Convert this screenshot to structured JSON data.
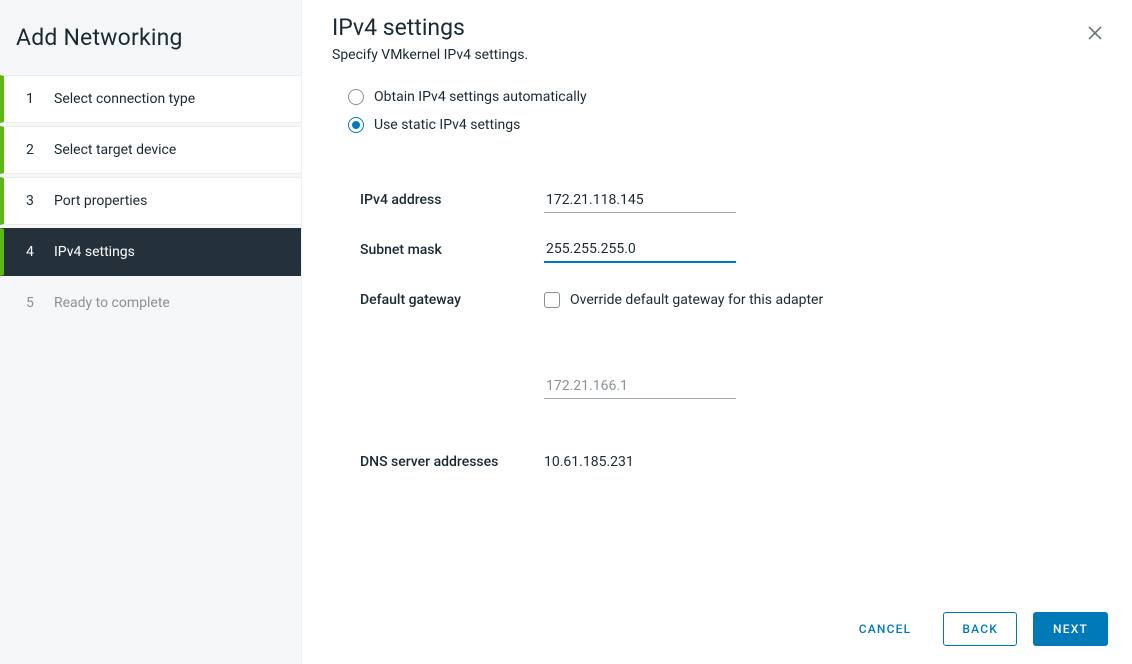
{
  "sidebar": {
    "title": "Add Networking",
    "steps": [
      {
        "num": "1",
        "label": "Select connection type"
      },
      {
        "num": "2",
        "label": "Select target device"
      },
      {
        "num": "3",
        "label": "Port properties"
      },
      {
        "num": "4",
        "label": "IPv4 settings"
      },
      {
        "num": "5",
        "label": "Ready to complete"
      }
    ]
  },
  "main": {
    "title": "IPv4 settings",
    "subtitle": "Specify VMkernel IPv4 settings.",
    "radio_auto": "Obtain IPv4 settings automatically",
    "radio_static": "Use static IPv4 settings",
    "labels": {
      "ipv4_address": "IPv4 address",
      "subnet_mask": "Subnet mask",
      "default_gateway": "Default gateway",
      "dns_servers": "DNS server addresses"
    },
    "values": {
      "ipv4_address": "172.21.118.145",
      "subnet_mask": "255.255.255.0",
      "gateway_placeholder": "172.21.166.1",
      "dns_servers": "10.61.185.231"
    },
    "checkbox_override": "Override default gateway for this adapter"
  },
  "footer": {
    "cancel": "CANCEL",
    "back": "BACK",
    "next": "NEXT"
  }
}
